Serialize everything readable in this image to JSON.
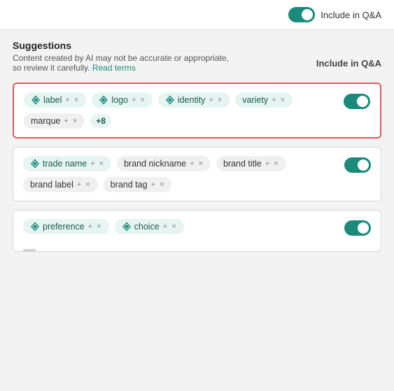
{
  "topBar": {
    "toggleLabel": "Include in Q&A",
    "toggleOn": true
  },
  "suggestions": {
    "title": "Suggestions",
    "description": "Content created by AI may not be accurate or appropriate, so review it carefully.",
    "readTermsLabel": "Read terms",
    "includeLabel": "Include in Q&A"
  },
  "cards": [
    {
      "id": "card-1",
      "highlighted": true,
      "toggleOn": true,
      "chips": [
        {
          "type": "teal",
          "text": "label",
          "hasIcon": true
        },
        {
          "type": "teal",
          "text": "logo",
          "hasIcon": true
        },
        {
          "type": "teal",
          "text": "identity",
          "hasIcon": true
        },
        {
          "type": "teal",
          "text": "variety",
          "hasIcon": false
        },
        {
          "type": "plain",
          "text": "marque",
          "hasIcon": false
        }
      ],
      "moreBadge": "+8"
    },
    {
      "id": "card-2",
      "highlighted": false,
      "toggleOn": true,
      "chips": [
        {
          "type": "teal",
          "text": "trade name",
          "hasIcon": true
        },
        {
          "type": "plain",
          "text": "brand nickname",
          "hasIcon": false
        },
        {
          "type": "plain",
          "text": "brand title",
          "hasIcon": false
        },
        {
          "type": "plain",
          "text": "brand label",
          "hasIcon": false
        },
        {
          "type": "plain",
          "text": "brand tag",
          "hasIcon": false
        }
      ],
      "moreBadge": null
    },
    {
      "id": "card-3",
      "highlighted": false,
      "toggleOn": true,
      "chips": [
        {
          "type": "teal",
          "text": "preference",
          "hasIcon": true
        },
        {
          "type": "teal",
          "text": "choice",
          "hasIcon": true
        }
      ],
      "moreBadge": null,
      "partial": true
    }
  ],
  "icons": {
    "diamond": "◈",
    "plus": "+",
    "close": "×"
  }
}
